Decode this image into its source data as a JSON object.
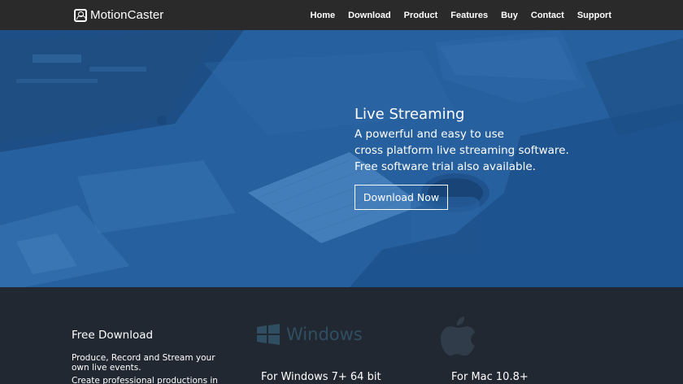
{
  "nav": {
    "brand": "MotionCaster",
    "items": [
      "Home",
      "Download",
      "Product",
      "Features",
      "Buy",
      "Contact",
      "Support"
    ]
  },
  "hero": {
    "title": "Live Streaming",
    "lines": [
      "A powerful and easy to use",
      "cross platform live streaming software.",
      "Free software trial also available."
    ],
    "cta": "Download Now"
  },
  "download": {
    "title": "Free Download",
    "paragraph1": "Produce, Record and Stream your own live events.",
    "paragraph2": "Create professional productions in",
    "windows_logo_text": "Windows",
    "windows_label": "For Windows 7+ 64 bit",
    "mac_label": "For Mac 10.8+"
  },
  "colors": {
    "nav_bg": "#2a2a2a",
    "hero_overlay": "#27609e",
    "section_bg": "#222831"
  }
}
